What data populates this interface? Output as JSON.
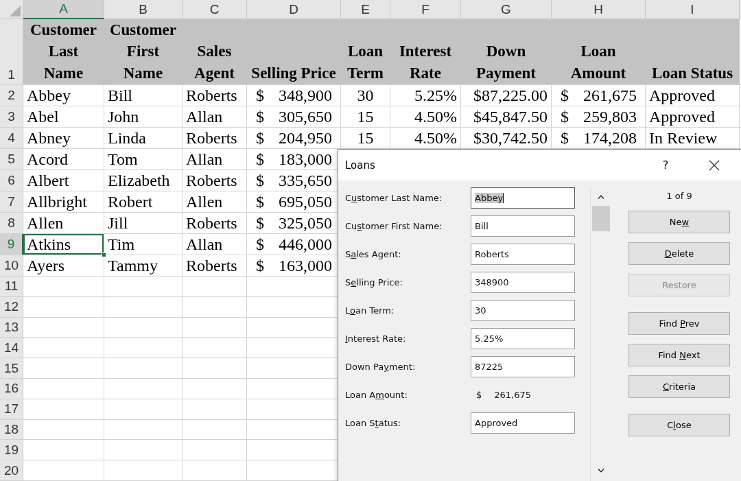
{
  "sheet": {
    "columns": [
      {
        "letter": "A",
        "kind": "text",
        "selected": true
      },
      {
        "letter": "B",
        "kind": "text",
        "selected": false
      },
      {
        "letter": "C",
        "kind": "text",
        "selected": false
      },
      {
        "letter": "D",
        "kind": "accounting",
        "selected": false
      },
      {
        "letter": "E",
        "kind": "center",
        "selected": false
      },
      {
        "letter": "F",
        "kind": "right",
        "selected": false
      },
      {
        "letter": "G",
        "kind": "right",
        "selected": false
      },
      {
        "letter": "H",
        "kind": "accounting",
        "selected": false
      },
      {
        "letter": "I",
        "kind": "text",
        "selected": false
      }
    ],
    "rows": [
      {
        "number": "1",
        "kind": "header",
        "selected": false,
        "cells": [
          "Customer\nLast\nName",
          "Customer\nFirst\nName",
          "Sales\nAgent",
          "Selling Price",
          "Loan\nTerm",
          "Interest\nRate",
          "Down\nPayment",
          "Loan\nAmount",
          "Loan Status"
        ]
      },
      {
        "number": "2",
        "kind": "data",
        "selected": false,
        "cells": [
          "Abbey",
          "Bill",
          "Roberts",
          {
            "symbol": "$",
            "amount": "348,900"
          },
          "30",
          "5.25%",
          "$87,225.00",
          {
            "symbol": "$",
            "amount": "261,675"
          },
          "Approved"
        ]
      },
      {
        "number": "3",
        "kind": "data",
        "selected": false,
        "cells": [
          "Abel",
          "John",
          "Allan",
          {
            "symbol": "$",
            "amount": "305,650"
          },
          "15",
          "4.50%",
          "$45,847.50",
          {
            "symbol": "$",
            "amount": "259,803"
          },
          "Approved"
        ]
      },
      {
        "number": "4",
        "kind": "data",
        "selected": false,
        "cells": [
          "Abney",
          "Linda",
          "Roberts",
          {
            "symbol": "$",
            "amount": "204,950"
          },
          "15",
          "4.50%",
          "$30,742.50",
          {
            "symbol": "$",
            "amount": "174,208"
          },
          "In Review"
        ]
      },
      {
        "number": "5",
        "kind": "data",
        "selected": false,
        "cells": [
          "Acord",
          "Tom",
          "Allan",
          {
            "symbol": "$",
            "amount": "183,000"
          }
        ]
      },
      {
        "number": "6",
        "kind": "data",
        "selected": false,
        "cells": [
          "Albert",
          "Elizabeth",
          "Roberts",
          {
            "symbol": "$",
            "amount": "335,650"
          }
        ]
      },
      {
        "number": "7",
        "kind": "data",
        "selected": false,
        "cells": [
          "Allbright",
          "Robert",
          "Allen",
          {
            "symbol": "$",
            "amount": "695,050"
          }
        ]
      },
      {
        "number": "8",
        "kind": "data",
        "selected": false,
        "cells": [
          "Allen",
          "Jill",
          "Roberts",
          {
            "symbol": "$",
            "amount": "325,050"
          }
        ]
      },
      {
        "number": "9",
        "kind": "data",
        "selected": true,
        "cells": [
          "Atkins",
          "Tim",
          "Allan",
          {
            "symbol": "$",
            "amount": "446,000"
          }
        ]
      },
      {
        "number": "10",
        "kind": "data",
        "selected": false,
        "cells": [
          "Ayers",
          "Tammy",
          "Roberts",
          {
            "symbol": "$",
            "amount": "163,000"
          }
        ]
      },
      {
        "number": "11",
        "kind": "data",
        "selected": false
      },
      {
        "number": "12",
        "kind": "data",
        "selected": false
      },
      {
        "number": "13",
        "kind": "data",
        "selected": false
      },
      {
        "number": "14",
        "kind": "data",
        "selected": false
      },
      {
        "number": "15",
        "kind": "data",
        "selected": false
      },
      {
        "number": "16",
        "kind": "data",
        "selected": false
      },
      {
        "number": "17",
        "kind": "data",
        "selected": false
      },
      {
        "number": "18",
        "kind": "data",
        "selected": false
      },
      {
        "number": "19",
        "kind": "data",
        "selected": false
      },
      {
        "number": "20",
        "kind": "data",
        "selected": false
      }
    ]
  },
  "dialog": {
    "title": "Loans",
    "help": "?",
    "form_rows": [
      {
        "kind": "field",
        "label_parts": [
          {
            "text": "C",
            "underlined": false
          },
          {
            "text": "u",
            "underlined": true
          },
          {
            "text": "stomer Last Name:",
            "underlined": false
          }
        ],
        "value": "Abbey",
        "focused": true
      },
      {
        "kind": "field",
        "label_parts": [
          {
            "text": "Cu",
            "underlined": false
          },
          {
            "text": "s",
            "underlined": true
          },
          {
            "text": "tomer First Name:",
            "underlined": false
          }
        ],
        "value": "Bill",
        "focused": false
      },
      {
        "kind": "field",
        "label_parts": [
          {
            "text": "S",
            "underlined": false
          },
          {
            "text": "a",
            "underlined": true
          },
          {
            "text": "les Agent:",
            "underlined": false
          }
        ],
        "value": "Roberts",
        "focused": false
      },
      {
        "kind": "field",
        "label_parts": [
          {
            "text": "S",
            "underlined": false
          },
          {
            "text": "e",
            "underlined": true
          },
          {
            "text": "lling Price:",
            "underlined": false
          }
        ],
        "value": "348900",
        "focused": false
      },
      {
        "kind": "field",
        "label_parts": [
          {
            "text": "L",
            "underlined": false
          },
          {
            "text": "o",
            "underlined": true
          },
          {
            "text": "an Term:",
            "underlined": false
          }
        ],
        "value": "30",
        "focused": false
      },
      {
        "kind": "field",
        "label_parts": [
          {
            "text": "I",
            "underlined": true
          },
          {
            "text": "nterest Rate:",
            "underlined": false
          }
        ],
        "value": "5.25%",
        "focused": false
      },
      {
        "kind": "field",
        "label_parts": [
          {
            "text": "Down Pa",
            "underlined": false
          },
          {
            "text": "y",
            "underlined": true
          },
          {
            "text": "ment:",
            "underlined": false
          }
        ],
        "value": "87225",
        "focused": false
      },
      {
        "kind": "readout",
        "label_parts": [
          {
            "text": "Loan A",
            "underlined": false
          },
          {
            "text": "m",
            "underlined": true
          },
          {
            "text": "ount:",
            "underlined": false
          }
        ],
        "symbol": "$",
        "value": "261,675",
        "focused": false
      },
      {
        "kind": "field",
        "label_parts": [
          {
            "text": "Loan S",
            "underlined": false
          },
          {
            "text": "t",
            "underlined": true
          },
          {
            "text": "atus:",
            "underlined": false
          }
        ],
        "value": "Approved",
        "focused": false
      }
    ],
    "record_counter": "1 of 9",
    "button_groups": [
      [
        {
          "label_parts": [
            {
              "text": "Ne",
              "underlined": false
            },
            {
              "text": "w",
              "underlined": true
            }
          ],
          "disabled": false
        },
        {
          "label_parts": [
            {
              "text": "D",
              "underlined": true
            },
            {
              "text": "elete",
              "underlined": false
            }
          ],
          "disabled": false
        },
        {
          "label_parts": [
            {
              "text": "Restore",
              "underlined": false
            }
          ],
          "disabled": true
        }
      ],
      [
        {
          "label_parts": [
            {
              "text": "Find ",
              "underlined": false
            },
            {
              "text": "P",
              "underlined": true
            },
            {
              "text": "rev",
              "underlined": false
            }
          ],
          "disabled": false
        },
        {
          "label_parts": [
            {
              "text": "Find ",
              "underlined": false
            },
            {
              "text": "N",
              "underlined": true
            },
            {
              "text": "ext",
              "underlined": false
            }
          ],
          "disabled": false
        },
        {
          "label_parts": [
            {
              "text": "C",
              "underlined": true
            },
            {
              "text": "riteria",
              "underlined": false
            }
          ],
          "disabled": false
        }
      ],
      [
        {
          "label_parts": [
            {
              "text": "C",
              "underlined": false
            },
            {
              "text": "l",
              "underlined": true
            },
            {
              "text": "ose",
              "underlined": false
            }
          ],
          "disabled": false
        }
      ]
    ]
  }
}
